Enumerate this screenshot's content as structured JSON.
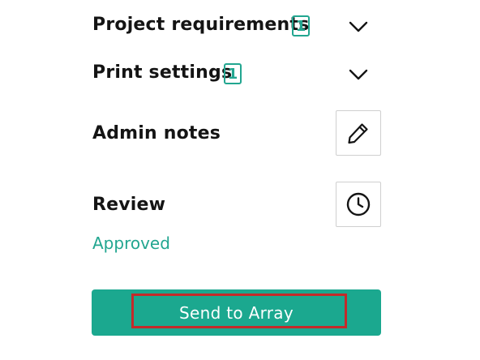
{
  "sections": [
    {
      "id": "project-requirements",
      "label": "Project requirements",
      "badge": "1"
    },
    {
      "id": "print-settings",
      "label": "Print settings",
      "badge": "1"
    }
  ],
  "admin_notes": {
    "label": "Admin notes",
    "icon": "pencil-icon"
  },
  "review": {
    "label": "Review",
    "icon": "clock-icon",
    "status": "Approved"
  },
  "send_button": {
    "label": "Send to Array"
  },
  "colors": {
    "accent": "#22a690",
    "button": "#1ba88f",
    "highlight": "#c42a2a"
  }
}
